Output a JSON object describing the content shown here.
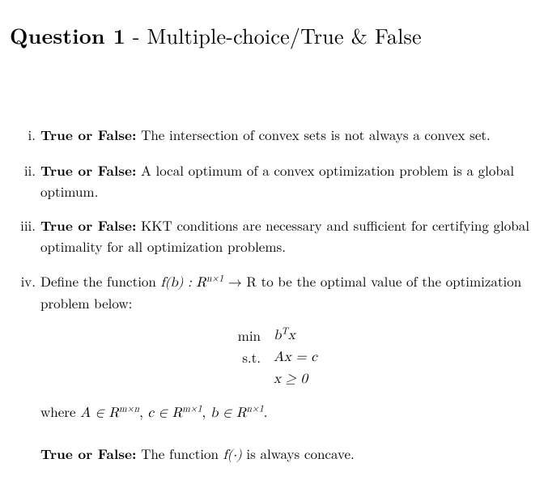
{
  "title": {
    "bold": "Question 1",
    "rest": " - Multiple-choice/True & False"
  },
  "items": {
    "i": {
      "label": "True or False:",
      "text": " The intersection of convex sets is not always a convex set."
    },
    "ii": {
      "label": "True or False:",
      "text": " A local optimum of a convex optimization problem is a global optimum."
    },
    "iii": {
      "label": "True or False:",
      "text": " KKT conditions are necessary and sufficient for certifying global optimality for all optimization problems."
    },
    "iv": {
      "intro_a": "Define the function ",
      "func": "f(b) : R",
      "func_sup": "n×1",
      "func_arrow": " → R",
      "intro_b": " to be the optimal value of the optimization problem below:",
      "opt": {
        "min_lead": "min",
        "min_body": "b",
        "min_body_sup": "T",
        "min_body_tail": "x",
        "st_lead": "s.t.",
        "st_body": "Ax = c",
        "nonneg": "x ≥ 0"
      },
      "where_a": "where ",
      "where_A": "A ∈ R",
      "where_A_sup": "m×n",
      "comma1": ", ",
      "where_c": "c ∈ R",
      "where_c_sup": "m×1",
      "comma2": ", ",
      "where_b": "b ∈ R",
      "where_b_sup": "n×1",
      "period": ".",
      "final_label": "True or False:",
      "final_text_a": " The function ",
      "final_func": "f(·)",
      "final_text_b": " is always concave."
    }
  }
}
